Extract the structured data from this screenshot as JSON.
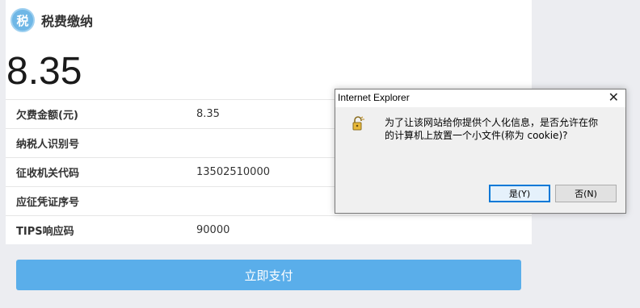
{
  "header": {
    "logo_char": "税",
    "title": "税费缴纳"
  },
  "amount": "8.35",
  "rows": [
    {
      "label": "欠费金额(元)",
      "value": "8.35"
    },
    {
      "label": "纳税人识别号",
      "value": ""
    },
    {
      "label": "征收机关代码",
      "value": "13502510000"
    },
    {
      "label": "应征凭证序号",
      "value": ""
    },
    {
      "label": "TIPS响应码",
      "value": "90000"
    }
  ],
  "pay_button": "立即支付",
  "dialog": {
    "title": "Internet Explorer",
    "close": "✕",
    "message": "为了让该网站给你提供个人化信息，是否允许在你的计算机上放置一个小文件(称为 cookie)?",
    "yes": "是(Y)",
    "no": "否(N)"
  },
  "colors": {
    "accent": "#5aaeea",
    "logo": "#6fb7e6"
  }
}
